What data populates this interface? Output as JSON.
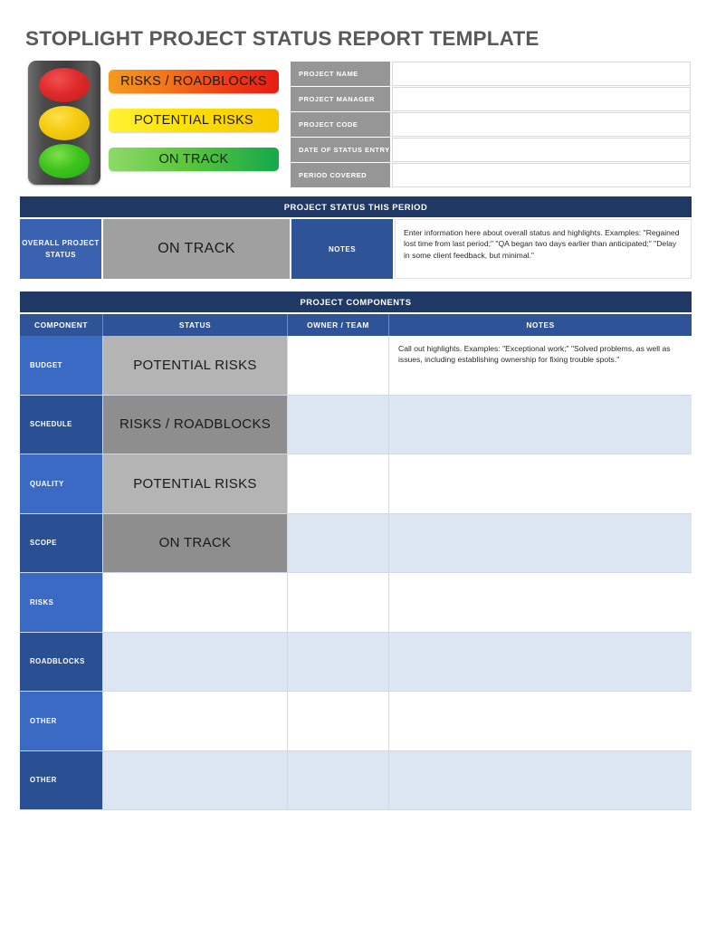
{
  "document": {
    "title": "STOPLIGHT PROJECT STATUS REPORT TEMPLATE"
  },
  "legend": {
    "items": [
      {
        "label": "RISKS / ROADBLOCKS",
        "color": "#ef3b18",
        "lamp": "red"
      },
      {
        "label": "POTENTIAL RISKS",
        "color": "#ffe000",
        "lamp": "yellow"
      },
      {
        "label": "ON TRACK",
        "color": "#5cc63c",
        "lamp": "green"
      }
    ]
  },
  "project_info": {
    "rows": [
      {
        "label": "PROJECT NAME",
        "value": ""
      },
      {
        "label": "PROJECT MANAGER",
        "value": ""
      },
      {
        "label": "PROJECT CODE",
        "value": ""
      },
      {
        "label": "DATE OF STATUS ENTRY",
        "value": ""
      },
      {
        "label": "PERIOD COVERED",
        "value": ""
      }
    ]
  },
  "status_section": {
    "banner": "PROJECT STATUS THIS PERIOD",
    "overall_label": "OVERALL PROJECT STATUS",
    "overall_status": "ON TRACK",
    "notes_label": "NOTES",
    "notes_text": "Enter information here about overall status and highlights. Examples: \"Regained lost time from last period;\" \"QA began two days earlier than anticipated;\" \"Delay in some client feedback, but minimal.\""
  },
  "components_section": {
    "banner": "PROJECT COMPONENTS",
    "headers": {
      "component": "COMPONENT",
      "status": "STATUS",
      "owner": "OWNER / TEAM",
      "notes": "NOTES"
    },
    "rows": [
      {
        "component": "BUDGET",
        "status": "POTENTIAL RISKS",
        "owner": "",
        "notes": "Call out highlights. Examples: \"Exceptional work;\" \"Solved problems, as well as issues, including establishing ownership for fixing trouble spots.\""
      },
      {
        "component": "SCHEDULE",
        "status": "RISKS / ROADBLOCKS",
        "owner": "",
        "notes": ""
      },
      {
        "component": "QUALITY",
        "status": "POTENTIAL RISKS",
        "owner": "",
        "notes": ""
      },
      {
        "component": "SCOPE",
        "status": "ON TRACK",
        "owner": "",
        "notes": ""
      },
      {
        "component": "RISKS",
        "status": "",
        "owner": "",
        "notes": ""
      },
      {
        "component": "ROADBLOCKS",
        "status": "",
        "owner": "",
        "notes": ""
      },
      {
        "component": "OTHER",
        "status": "",
        "owner": "",
        "notes": ""
      },
      {
        "component": "OTHER",
        "status": "",
        "owner": "",
        "notes": ""
      }
    ]
  },
  "colors": {
    "banner_navy": "#1f3864",
    "header_blue": "#2e5396",
    "label_blue_light": "#3b6ac4",
    "label_blue_dark": "#2a4f93",
    "row_alt_blue": "#dce6f2",
    "status_gray_light": "#b4b4b4",
    "status_gray_dark": "#8e8e8e",
    "title_gray": "#595959"
  }
}
